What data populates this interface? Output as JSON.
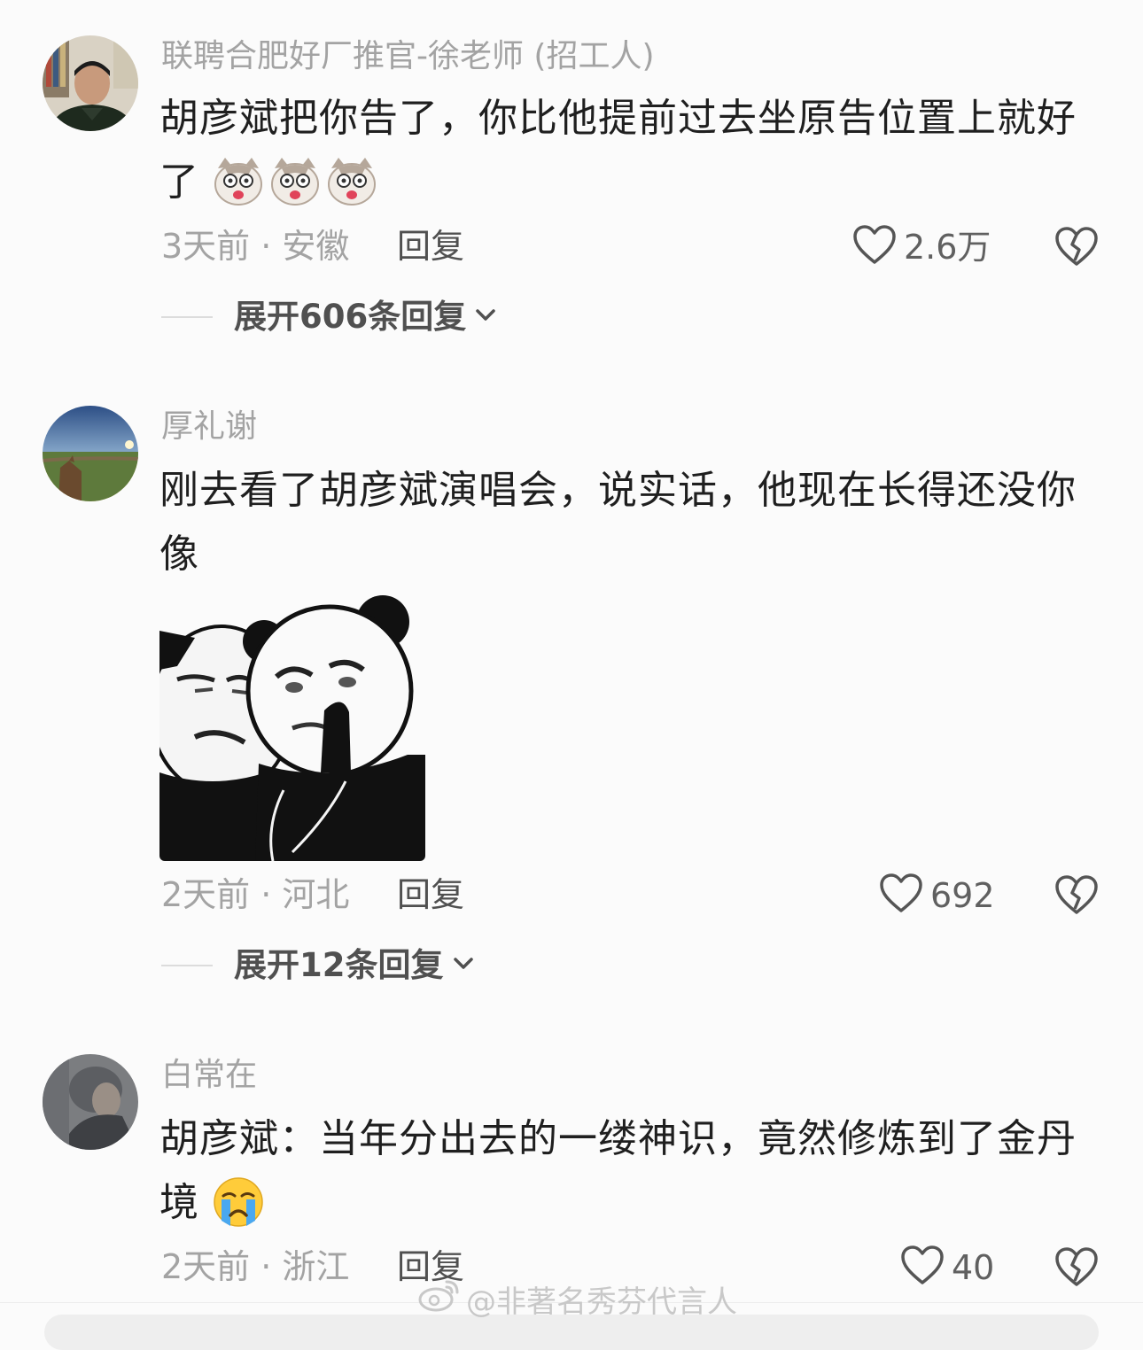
{
  "comments": [
    {
      "username": "联聘合肥好厂推官-徐老师 (招工人)",
      "text": "胡彦斌把你告了，你比他提前过去坐原告位置上就好了",
      "emoji": "cat-face-emoji",
      "time_location": "3天前 · 安徽",
      "reply_label": "回复",
      "likes": "2.6万",
      "expand_label": "展开606条回复"
    },
    {
      "username": "厚礼谢",
      "text": "刚去看了胡彦斌演唱会，说实话，他现在长得还没你像",
      "sticker": "panda-meme-sticker",
      "time_location": "2天前 · 河北",
      "reply_label": "回复",
      "likes": "692",
      "expand_label": "展开12条回复"
    },
    {
      "username": "白常在",
      "text": "胡彦斌：当年分出去的一缕神识，竟然修炼到了金丹境",
      "emoji": "crying-face-emoji",
      "time_location": "2天前 · 浙江",
      "reply_label": "回复",
      "likes": "40"
    }
  ],
  "watermark": "@非著名秀芬代言人",
  "colors": {
    "background": "#fbfbfb",
    "username": "#a3a3a3",
    "text": "#1f1f1f",
    "meta": "#a3a3a3",
    "action": "#505050"
  }
}
